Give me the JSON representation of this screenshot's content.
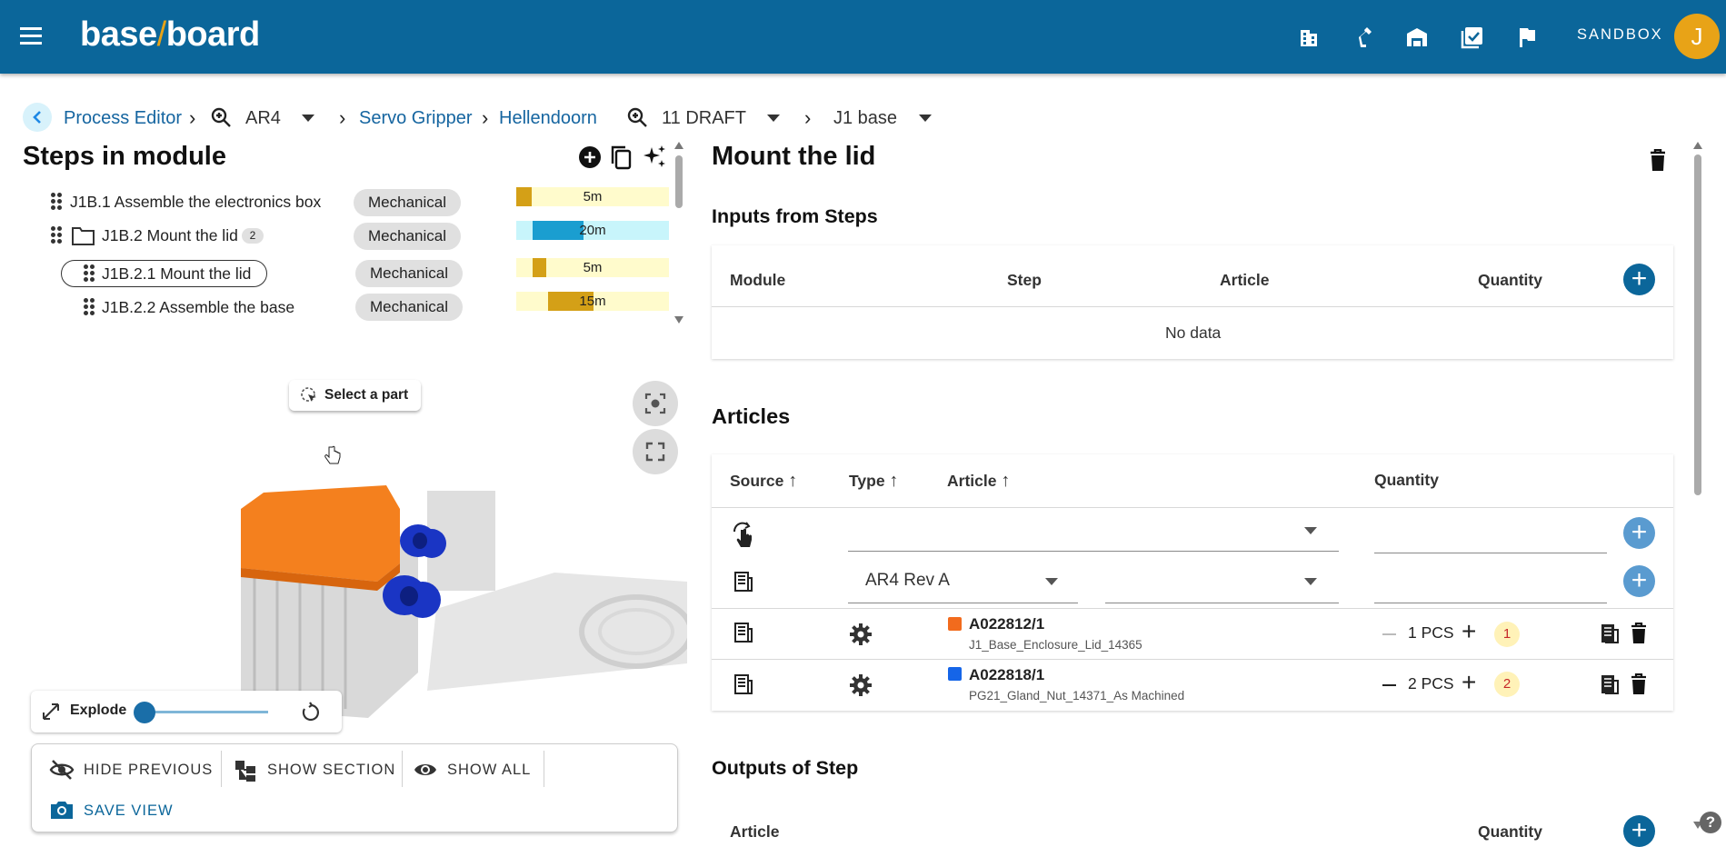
{
  "appbar": {
    "menu_icon": "hamburger-icon",
    "logo_left": "base",
    "logo_right": "board",
    "nav_icons": [
      "building-icon",
      "robot-arm-icon",
      "warehouse-icon",
      "checklist-icon",
      "flag-icon"
    ],
    "env_label": "SANDBOX",
    "avatar_letter": "J",
    "avatar_color": "#e8a317",
    "brand_color": "#0b669a"
  },
  "breadcrumb": {
    "items": [
      {
        "label": "Process Editor"
      },
      {
        "label": "AR4"
      },
      {
        "label": "Servo Gripper"
      },
      {
        "label": "Hellendoorn"
      },
      {
        "label": "11 DRAFT"
      },
      {
        "label": "J1 base"
      }
    ]
  },
  "steps_panel": {
    "title": "Steps in module",
    "steps": [
      {
        "label": "J1B.1 Assemble the electronics box",
        "type": "Mechanical",
        "duration": "5m",
        "bar_color": "#d4a017",
        "fill": 0.1
      },
      {
        "label": "J1B.2 Mount the lid",
        "badge": "2",
        "type": "Mechanical",
        "duration": "20m",
        "bar_color": "#1a9ed0",
        "fill": 0.33
      },
      {
        "label": "J1B.2.1 Mount the lid",
        "type": "Mechanical",
        "duration": "5m",
        "bar_color": "#d4a017",
        "fill": 0.08
      },
      {
        "label": "J1B.2.2 Assemble the base",
        "type": "Mechanical",
        "duration": "15m",
        "bar_color": "#d4a017",
        "fill": 0.25
      }
    ]
  },
  "viewer": {
    "select_part": "Select a part",
    "explode_label": "Explode",
    "explode_value": 0,
    "toolbar": {
      "hide_previous": "HIDE PREVIOUS",
      "show_section": "SHOW SECTION",
      "show_all": "SHOW ALL",
      "save_view": "SAVE VIEW"
    }
  },
  "detail": {
    "title": "Mount the lid",
    "inputs": {
      "heading": "Inputs from Steps",
      "columns": [
        "Module",
        "Step",
        "Article",
        "Quantity"
      ],
      "empty": "No data"
    },
    "articles": {
      "heading": "Articles",
      "columns": [
        "Source",
        "Type",
        "Article",
        "Quantity"
      ],
      "revision_select": "AR4 Rev A",
      "rows": [
        {
          "code": "A022812/1",
          "name": "J1_Base_Enclosure_Lid_14365",
          "qty": "1 PCS",
          "count": "1",
          "color": "#f26b1d"
        },
        {
          "code": "A022818/1",
          "name": "PG21_Gland_Nut_14371_As Machined",
          "qty": "2 PCS",
          "count": "2",
          "color": "#1565e8"
        }
      ]
    },
    "outputs": {
      "heading": "Outputs of Step",
      "columns": [
        "Article",
        "Quantity"
      ]
    }
  }
}
